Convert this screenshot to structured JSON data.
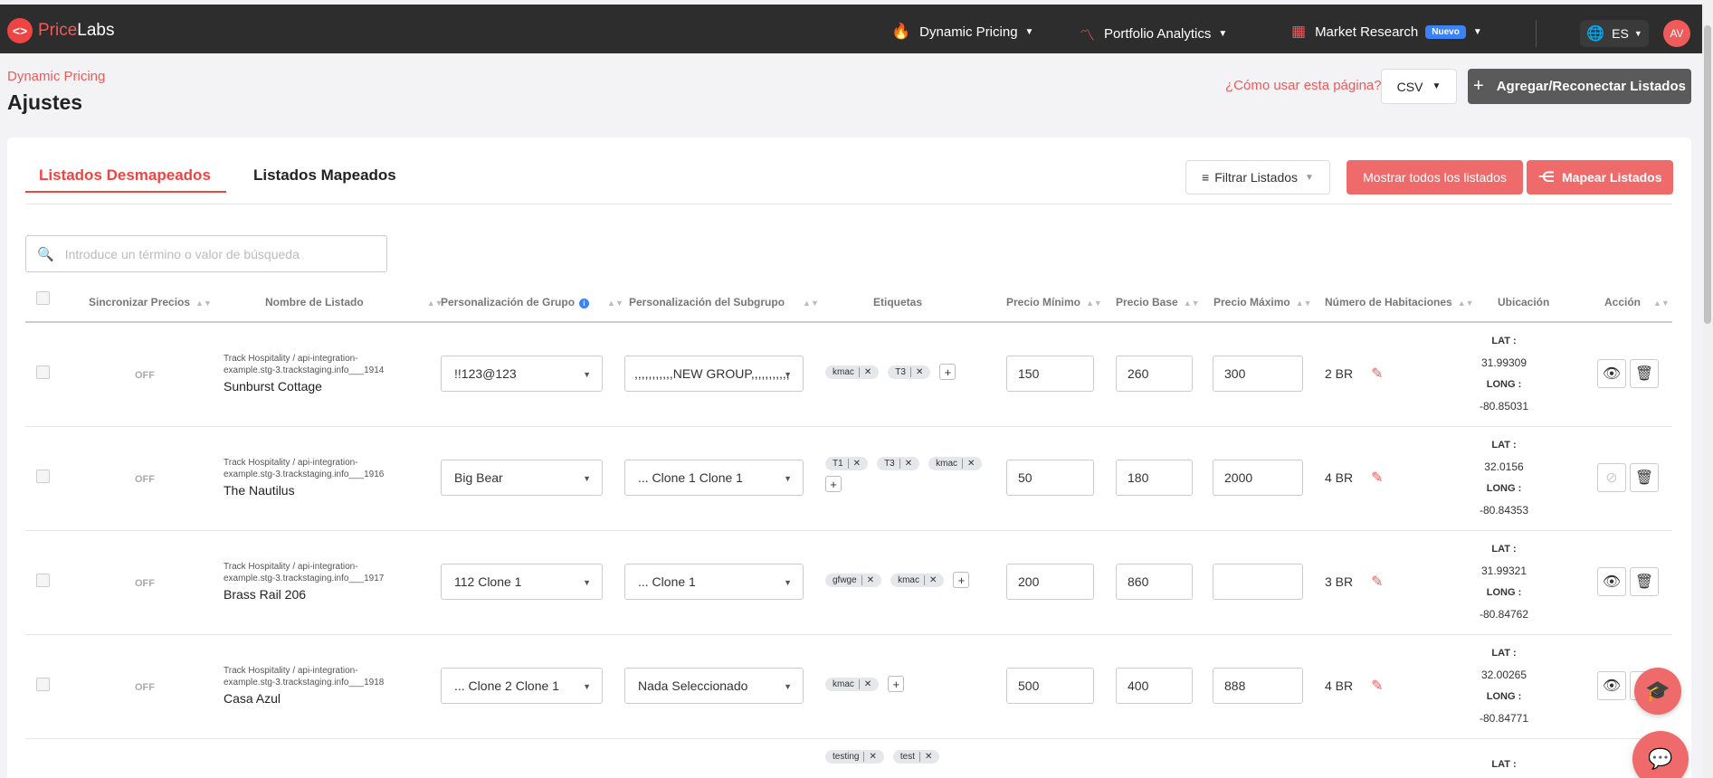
{
  "brand": {
    "name_a": "Price",
    "name_b": "Labs",
    "logo_icon": "code-brackets-icon"
  },
  "nav": [
    {
      "label": "Dynamic Pricing",
      "icon": "flame-icon"
    },
    {
      "label": "Portfolio Analytics",
      "icon": "trend-line-icon"
    },
    {
      "label": "Market Research",
      "icon": "grid-icon",
      "badge": "Nuevo"
    }
  ],
  "lang": "ES",
  "user_initials": "AV",
  "breadcrumb": "Dynamic Pricing",
  "page_title": "Ajustes",
  "help_link": "¿Cómo usar esta página?",
  "export_format": "CSV",
  "add_button": "Agregar/Reconectar Listados",
  "tabs": [
    "Listados Desmapeados",
    "Listados Mapeados"
  ],
  "filter_button": "Filtrar Listados",
  "show_all_button": "Mostrar todos los listados",
  "map_button": "Mapear Listados",
  "search": {
    "placeholder": "Introduce un término o valor de búsqueda",
    "value": ""
  },
  "columns": [
    "Sincronizar Precios",
    "Nombre de Listado",
    "Personalización de Grupo",
    "Personalización del Subgrupo",
    "Etiquetas",
    "Precio Mínimo",
    "Precio Base",
    "Precio Máximo",
    "Número de Habitaciones",
    "Ubicación",
    "Acción"
  ],
  "loc_labels": {
    "lat": "LAT :",
    "long": "LONG :"
  },
  "rows": [
    {
      "sync": "OFF",
      "source": "Track Hospitality / api-integration-example.stg-3.trackstaging.info___1914",
      "name": "Sunburst Cottage",
      "group": "!!123@123",
      "subgroup": ",,,,,,,,,,,NEW GROUP,,,,,,,,,,,",
      "tags": [
        "kmac",
        "T3"
      ],
      "min": "150",
      "base": "260",
      "max": "300",
      "rooms": "2 BR",
      "lat": "31.99309",
      "long": "-80.85031",
      "visible": true
    },
    {
      "sync": "OFF",
      "source": "Track Hospitality / api-integration-example.stg-3.trackstaging.info___1916",
      "name": "The Nautilus",
      "group": "Big Bear",
      "subgroup": "... Clone 1 Clone 1",
      "tags": [
        "T1",
        "T3",
        "kmac"
      ],
      "min": "50",
      "base": "180",
      "max": "2000",
      "rooms": "4 BR",
      "lat": "32.0156",
      "long": "-80.84353",
      "visible": false
    },
    {
      "sync": "OFF",
      "source": "Track Hospitality / api-integration-example.stg-3.trackstaging.info___1917",
      "name": "Brass Rail 206",
      "group": "112 Clone 1",
      "subgroup": "... Clone 1",
      "tags": [
        "gfwge",
        "kmac"
      ],
      "min": "200",
      "base": "860",
      "max": "",
      "rooms": "3 BR",
      "lat": "31.99321",
      "long": "-80.84762",
      "visible": true
    },
    {
      "sync": "OFF",
      "source": "Track Hospitality / api-integration-example.stg-3.trackstaging.info___1918",
      "name": "Casa Azul",
      "group": "... Clone 2 Clone 1",
      "subgroup": "Nada Seleccionado",
      "tags": [
        "kmac"
      ],
      "min": "500",
      "base": "400",
      "max": "888",
      "rooms": "4 BR",
      "lat": "32.00265",
      "long": "-80.84771",
      "visible": true
    }
  ],
  "partial_row": {
    "tags": [
      "testing",
      "test"
    ],
    "lat_label": "LAT :"
  },
  "colors": {
    "accent": "#ef4444",
    "topbar": "#2d2d2d",
    "button": "#ef6a6a",
    "badge": "#3b82f6"
  }
}
